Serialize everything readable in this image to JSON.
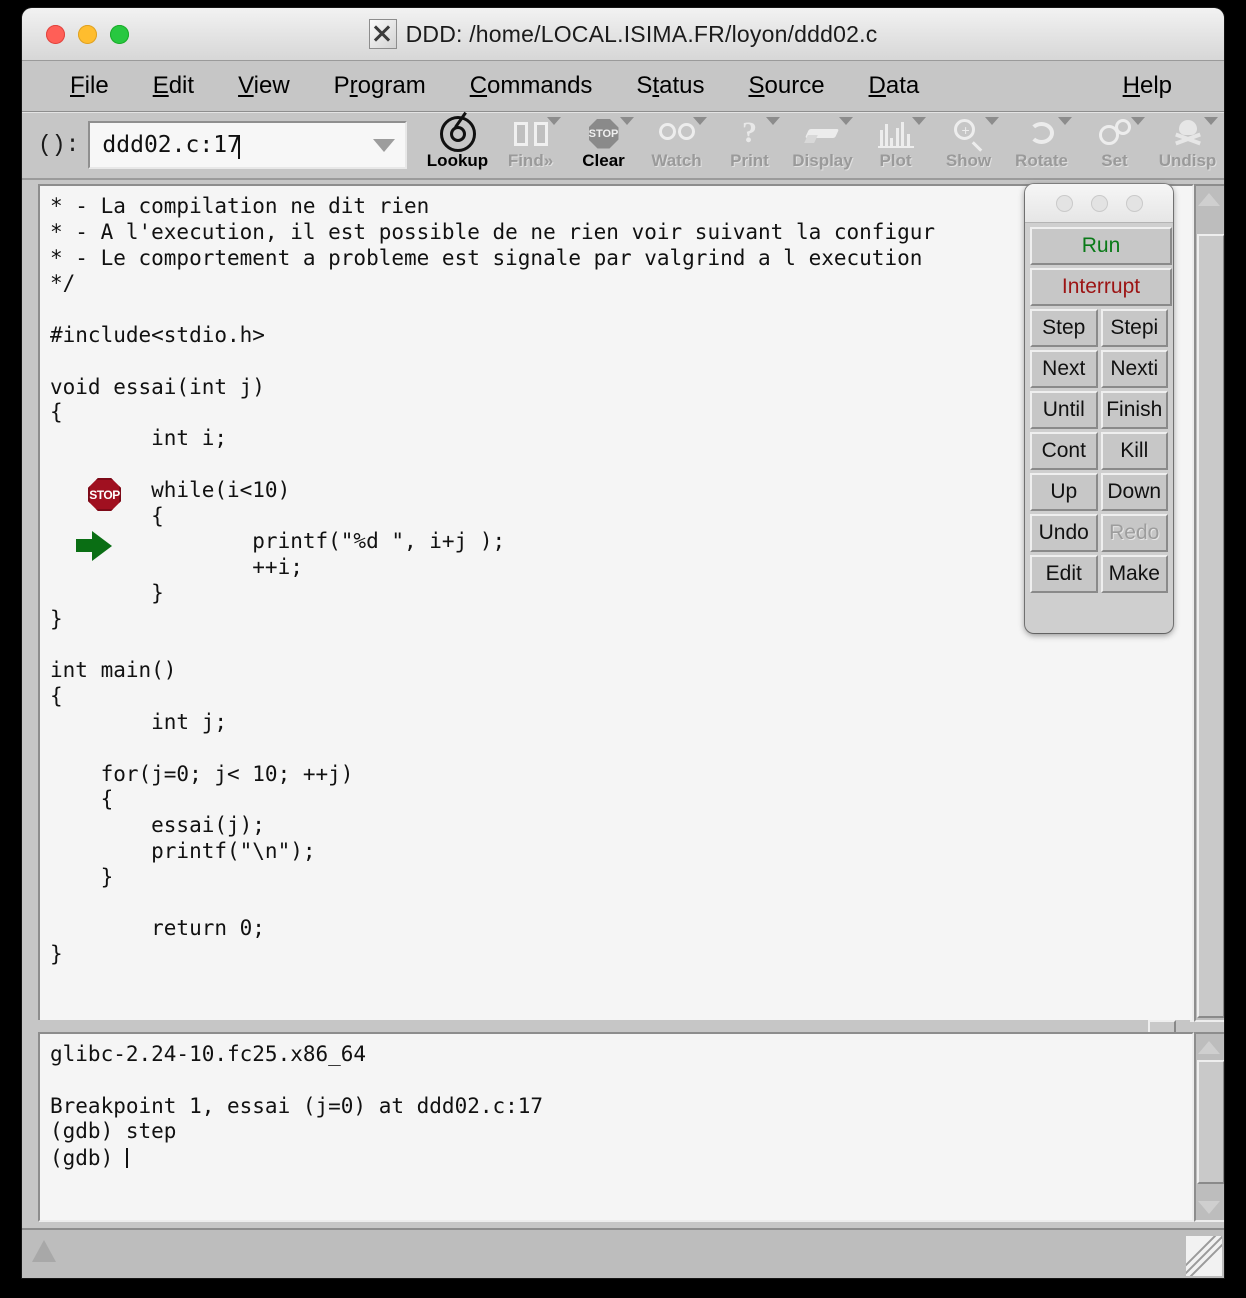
{
  "window": {
    "title": "DDD: /home/LOCAL.ISIMA.FR/loyon/ddd02.c",
    "app_icon": "x11-icon",
    "traffic_lights": [
      "close-button",
      "minimize-button",
      "zoom-button"
    ]
  },
  "menubar": {
    "items": [
      {
        "label": "File",
        "mnemonic": "F"
      },
      {
        "label": "Edit",
        "mnemonic": "E"
      },
      {
        "label": "View",
        "mnemonic": "V"
      },
      {
        "label": "Program",
        "mnemonic": "P"
      },
      {
        "label": "Commands",
        "mnemonic": "C"
      },
      {
        "label": "Status",
        "mnemonic": "t"
      },
      {
        "label": "Source",
        "mnemonic": "S"
      },
      {
        "label": "Data",
        "mnemonic": "D"
      }
    ],
    "help": {
      "label": "Help",
      "mnemonic": "H"
    }
  },
  "toolbar": {
    "arg_label": "():",
    "combo_value": "ddd02.c:17",
    "combo_placeholder": "",
    "buttons": [
      {
        "label": "Lookup",
        "icon": "target-icon",
        "enabled": true,
        "has_menu": false
      },
      {
        "label": "Find»",
        "icon": "binoculars-icon",
        "enabled": false,
        "has_menu": true
      },
      {
        "label": "Clear",
        "icon": "stop-sign-icon",
        "enabled": true,
        "has_menu": true
      },
      {
        "label": "Watch",
        "icon": "glasses-icon",
        "enabled": false,
        "has_menu": true
      },
      {
        "label": "Print",
        "icon": "question-icon",
        "enabled": false,
        "has_menu": true
      },
      {
        "label": "Display",
        "icon": "pencil-icon",
        "enabled": false,
        "has_menu": true
      },
      {
        "label": "Plot",
        "icon": "plot-icon",
        "enabled": false,
        "has_menu": true
      },
      {
        "label": "Show",
        "icon": "magnifier-icon",
        "enabled": false,
        "has_menu": true
      },
      {
        "label": "Rotate",
        "icon": "rotate-icon",
        "enabled": false,
        "has_menu": true
      },
      {
        "label": "Set",
        "icon": "gears-icon",
        "enabled": false,
        "has_menu": true
      },
      {
        "label": "Undisp",
        "icon": "skull-icon",
        "enabled": false,
        "has_menu": true
      }
    ]
  },
  "source": {
    "code": "* - La compilation ne dit rien\n* - A l'execution, il est possible de ne rien voir suivant la configur\n* - Le comportement a probleme est signale par valgrind a l execution\n*/\n\n#include<stdio.h>\n\nvoid essai(int j)\n{\n        int i;\n\n        while(i<10)\n        {\n                printf(\"%d \", i+j );\n                ++i;\n        }\n}\n\nint main()\n{\n        int j;\n\n    for(j=0; j< 10; ++j)\n    {\n        essai(j);\n        printf(\"\\n\");\n    }\n\n        return 0;\n}",
    "breakpoint_marker": "STOP",
    "current_line_marker": "current-execution-arrow"
  },
  "command_tool": {
    "buttons": [
      {
        "label": "Run",
        "state": "accent-green"
      },
      {
        "label": "Interrupt",
        "state": "accent-red"
      },
      {
        "label": "Step",
        "state": "normal"
      },
      {
        "label": "Stepi",
        "state": "normal"
      },
      {
        "label": "Next",
        "state": "normal"
      },
      {
        "label": "Nexti",
        "state": "normal"
      },
      {
        "label": "Until",
        "state": "normal"
      },
      {
        "label": "Finish",
        "state": "normal"
      },
      {
        "label": "Cont",
        "state": "normal"
      },
      {
        "label": "Kill",
        "state": "normal"
      },
      {
        "label": "Up",
        "state": "normal"
      },
      {
        "label": "Down",
        "state": "normal"
      },
      {
        "label": "Undo",
        "state": "normal"
      },
      {
        "label": "Redo",
        "state": "disabled"
      },
      {
        "label": "Edit",
        "state": "normal"
      },
      {
        "label": "Make",
        "state": "normal"
      }
    ]
  },
  "console": {
    "text": "glibc-2.24-10.fc25.x86_64\n\nBreakpoint 1, essai (j=0) at ddd02.c:17\n(gdb) step\n(gdb) "
  },
  "colors": {
    "window_chrome": "#c6c6c6",
    "pane_background": "#f5f5f5",
    "run_green": "#0a7a18",
    "interrupt_red": "#9c1414",
    "breakpoint_red": "#a01020",
    "arrow_green": "#0a6e14",
    "disabled_grey": "#9d9d9d"
  }
}
